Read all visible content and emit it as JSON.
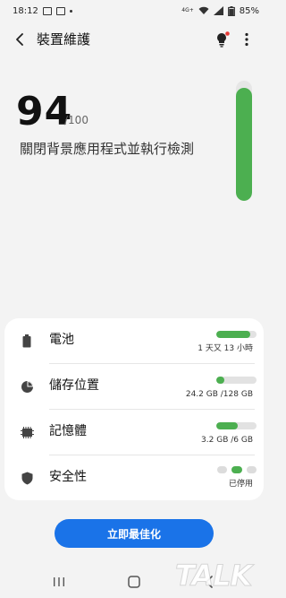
{
  "status_bar": {
    "time": "18:12",
    "network_label": "4G+",
    "battery_percent": "85%"
  },
  "header": {
    "title": "裝置維護"
  },
  "score": {
    "value": "94",
    "max": "/100",
    "fraction": 0.94,
    "message": "關閉背景應用程式並執行檢測"
  },
  "items": [
    {
      "label": "電池",
      "value": "1 天又 13 小時",
      "level": 0.85,
      "icon": "battery-icon"
    },
    {
      "label": "儲存位置",
      "value": "24.2 GB /128 GB",
      "level": 0.19,
      "icon": "storage-pie-icon"
    },
    {
      "label": "記憶體",
      "value": "3.2 GB /6 GB",
      "level": 0.53,
      "icon": "memory-chip-icon"
    },
    {
      "label": "安全性",
      "value": "已停用",
      "icon": "shield-icon"
    }
  ],
  "optimize_button": {
    "label": "立即最佳化"
  },
  "watermark": "TALK",
  "colors": {
    "accent_green": "#4caf50",
    "primary_blue": "#1a73e8",
    "background": "#f3f3f3",
    "tips_dot_red": "#e53935"
  }
}
